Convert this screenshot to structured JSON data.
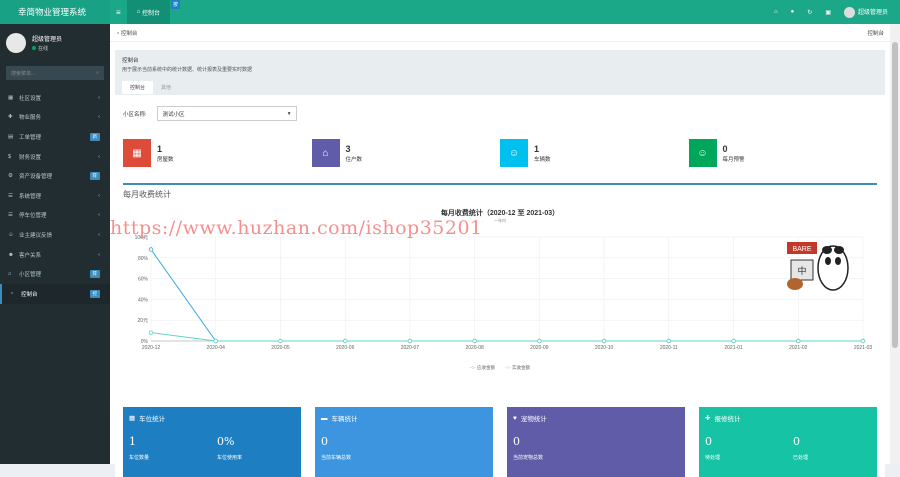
{
  "app": {
    "brand": "幸简物业管理系统"
  },
  "topbar": {
    "menu_icon": "≡",
    "tab_label": "控制台",
    "tab_badge": "按",
    "icons": [
      "home-icon",
      "bell-icon",
      "refresh-icon",
      "fullscreen-icon",
      "expand-icon"
    ],
    "user": "超级管理员"
  },
  "sidebar": {
    "username": "超级管理员",
    "status": "在线",
    "search_placeholder": "搜索菜单...",
    "items": [
      {
        "label": "社区设置",
        "icon": "building-icon",
        "badge": ""
      },
      {
        "label": "物业服务",
        "icon": "wrench-icon",
        "badge": ""
      },
      {
        "label": "工单管理",
        "icon": "ticket-icon",
        "badge": "新"
      },
      {
        "label": "财务设置",
        "icon": "dollar-icon",
        "badge": ""
      },
      {
        "label": "资产设备管理",
        "icon": "gear-icon",
        "badge": "荐"
      },
      {
        "label": "系统管理",
        "icon": "list-icon",
        "badge": ""
      },
      {
        "label": "停车位管理",
        "icon": "list-icon",
        "badge": ""
      },
      {
        "label": "业主建议反馈",
        "icon": "user-icon",
        "badge": ""
      },
      {
        "label": "客户关系",
        "icon": "users-icon",
        "badge": ""
      },
      {
        "label": "小区管理",
        "icon": "home-icon",
        "badge": "荐"
      },
      {
        "label": "控制台",
        "icon": "dashboard-icon",
        "badge": "控",
        "active": true
      }
    ]
  },
  "content": {
    "breadcrumb": "控制台",
    "breadcrumb_right": "控制台",
    "panel_title": "控制台",
    "panel_desc": "用于展示当前系统中的统计数据、统计报表及重要实时数据",
    "tabs": [
      "控制台",
      "其他"
    ],
    "community_label": "小区名称:",
    "community_value": "测试小区",
    "stats": [
      {
        "value": "1",
        "label": "房屋数",
        "color": "#dd4b39",
        "icon": "building-icon"
      },
      {
        "value": "3",
        "label": "住户数",
        "color": "#605ca8",
        "icon": "home-icon"
      },
      {
        "value": "1",
        "label": "车辆数",
        "color": "#00c0ef",
        "icon": "user-icon"
      },
      {
        "value": "0",
        "label": "每月预警",
        "color": "#00a65a",
        "icon": "user-icon"
      }
    ],
    "section_title": "每月收费统计",
    "watermark": "https://www.huzhan.com/ishop35201"
  },
  "chart_data": {
    "type": "line",
    "title": "每月收费统计（2020-12 至 2021-03）",
    "subtitle": "一年内",
    "categories": [
      "2020-12",
      "2020-04",
      "2020-05",
      "2020-06",
      "2020-07",
      "2020-08",
      "2020-09",
      "2020-10",
      "2020-11",
      "2021-01",
      "2021-02",
      "2021-03"
    ],
    "y_ticks": [
      "0%",
      "20元",
      "40%",
      "60%",
      "80%",
      "100元"
    ],
    "ylim": [
      0,
      100
    ],
    "grid": true,
    "legend_position": "bottom",
    "series": [
      {
        "name": "应收金额",
        "color": "#3aa6e0",
        "values": [
          88,
          0,
          0,
          0,
          0,
          0,
          0,
          0,
          0,
          0,
          0,
          0
        ]
      },
      {
        "name": "实收金额",
        "color": "#5fd6c8",
        "values": [
          8,
          0,
          0,
          0,
          0,
          0,
          0,
          0,
          0,
          0,
          0,
          0
        ]
      }
    ]
  },
  "cards": [
    {
      "title": "车位统计",
      "icon": "film-icon",
      "color": "#1d7fc2",
      "vals": [
        {
          "v": "1",
          "l": "车位数量"
        },
        {
          "v": "0%",
          "l": "车位使用率"
        }
      ]
    },
    {
      "title": "车辆统计",
      "icon": "car-icon",
      "color": "#3c95de",
      "vals": [
        {
          "v": "0",
          "l": "当前车辆总数"
        }
      ]
    },
    {
      "title": "宠物统计",
      "icon": "heart-icon",
      "color": "#605ca8",
      "vals": [
        {
          "v": "0",
          "l": "当前宠物总数"
        }
      ]
    },
    {
      "title": "报修统计",
      "icon": "wrench-icon",
      "color": "#16c3a4",
      "vals": [
        {
          "v": "0",
          "l": "待处理"
        },
        {
          "v": "0",
          "l": "已处理"
        }
      ]
    }
  ]
}
